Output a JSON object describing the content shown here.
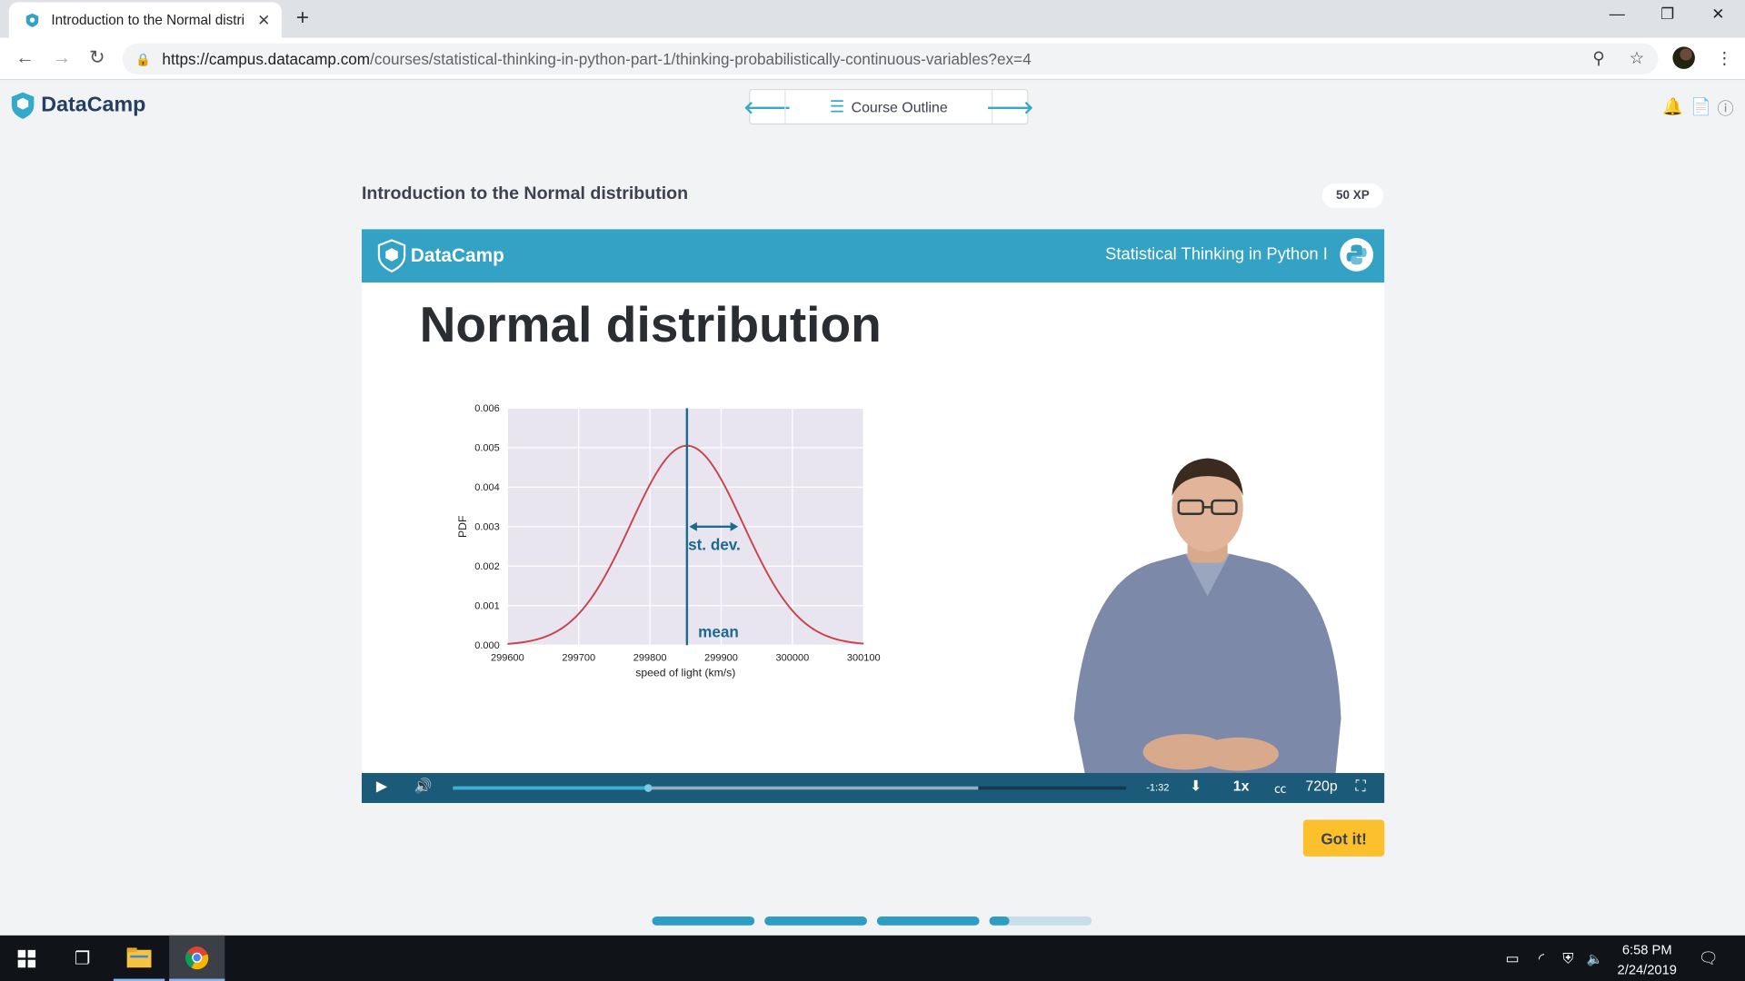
{
  "browser": {
    "tab_title": "Introduction to the Normal distri",
    "url_host": "https://campus.datacamp.com",
    "url_path": "/courses/statistical-thinking-in-python-part-1/thinking-probabilistically-continuous-variables?ex=4"
  },
  "app": {
    "logo_text": "DataCamp",
    "course_outline_label": "Course Outline"
  },
  "exercise": {
    "title": "Introduction to the Normal distribution",
    "xp_badge": "50 XP",
    "got_it_label": "Got it!"
  },
  "video": {
    "banner_logo": "DataCamp",
    "course_name": "Statistical Thinking in Python I",
    "slide_title": "Normal distribution",
    "time_remaining": "-1:32",
    "speed": "1x",
    "quality": "720p",
    "progress_played": 0.29,
    "progress_buffered": 0.78
  },
  "chart_data": {
    "type": "line",
    "title": "",
    "xlabel": "speed of light (km/s)",
    "ylabel": "PDF",
    "xlim": [
      299600,
      300100
    ],
    "ylim": [
      0.0,
      0.006
    ],
    "x_ticks": [
      "299600",
      "299700",
      "299800",
      "299900",
      "300000",
      "300100"
    ],
    "y_ticks": [
      "0.000",
      "0.001",
      "0.002",
      "0.003",
      "0.004",
      "0.005",
      "0.006"
    ],
    "series": [
      {
        "mean": 299852,
        "std": 79,
        "peak": 0.00505
      }
    ],
    "annotations": {
      "mean_label": "mean",
      "std_label": "st. dev."
    },
    "colors": {
      "curve": "#c8464b",
      "mean_line": "#1c6b8c",
      "plot_bg": "#e8e5f1"
    },
    "grid": true
  },
  "course_progress": [
    1.0,
    1.0,
    1.0,
    0.2
  ],
  "taskbar": {
    "time": "6:58 PM",
    "date": "2/24/2019"
  },
  "colors": {
    "accent": "#33a2c5",
    "brand_dark": "#263e63",
    "button_yellow": "#fcc02d"
  }
}
